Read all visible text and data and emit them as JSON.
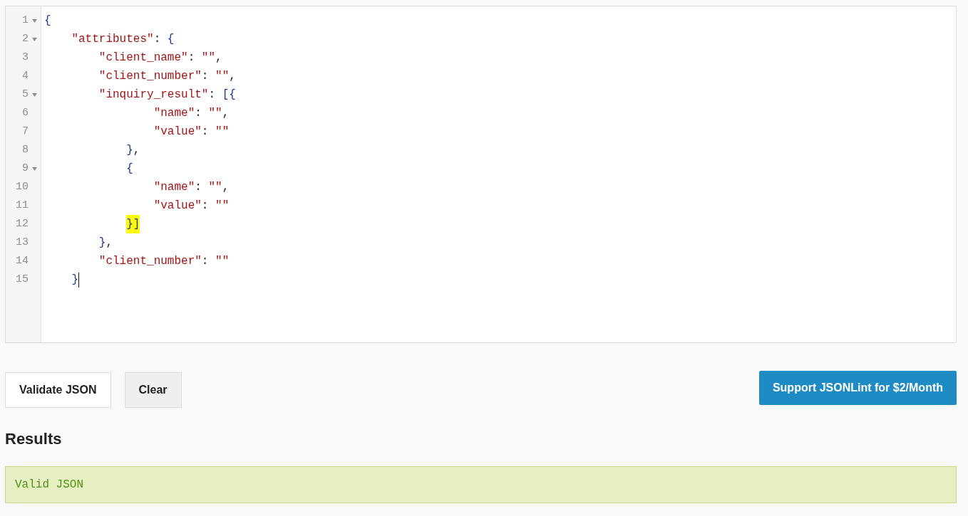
{
  "editor": {
    "lines": [
      {
        "number": "1",
        "code": "{",
        "foldable": true,
        "bracket_match": false,
        "cursor": false
      },
      {
        "number": "2",
        "code": "    \"attributes\": {",
        "foldable": true,
        "bracket_match": false,
        "cursor": false
      },
      {
        "number": "3",
        "code": "        \"client_name\": \"\",",
        "foldable": false,
        "bracket_match": false,
        "cursor": false
      },
      {
        "number": "4",
        "code": "        \"client_number\": \"\",",
        "foldable": false,
        "bracket_match": false,
        "cursor": false
      },
      {
        "number": "5",
        "code": "        \"inquiry_result\": [{",
        "foldable": true,
        "bracket_match": false,
        "cursor": false
      },
      {
        "number": "6",
        "code": "                \"name\": \"\",",
        "foldable": false,
        "bracket_match": false,
        "cursor": false
      },
      {
        "number": "7",
        "code": "                \"value\": \"\"",
        "foldable": false,
        "bracket_match": false,
        "cursor": false
      },
      {
        "number": "8",
        "code": "            },",
        "foldable": false,
        "bracket_match": false,
        "cursor": false
      },
      {
        "number": "9",
        "code": "            {",
        "foldable": true,
        "bracket_match": false,
        "cursor": false
      },
      {
        "number": "10",
        "code": "                \"name\": \"\",",
        "foldable": false,
        "bracket_match": false,
        "cursor": false
      },
      {
        "number": "11",
        "code": "                \"value\": \"\"",
        "foldable": false,
        "bracket_match": false,
        "cursor": false
      },
      {
        "number": "12",
        "code": "            }]",
        "foldable": false,
        "bracket_match": true,
        "cursor": false
      },
      {
        "number": "13",
        "code": "        },",
        "foldable": false,
        "bracket_match": false,
        "cursor": false
      },
      {
        "number": "14",
        "code": "        \"client_number\": \"\"",
        "foldable": false,
        "bracket_match": false,
        "cursor": false
      },
      {
        "number": "15",
        "code": "    }",
        "foldable": false,
        "bracket_match": false,
        "cursor": true
      }
    ]
  },
  "buttons": [
    {
      "label": "Validate JSON",
      "kind": "outline"
    },
    {
      "label": "Clear",
      "kind": "muted"
    }
  ],
  "support_button": {
    "label": "Support JSONLint for $2/Month"
  },
  "results": {
    "title": "Results",
    "message": "Valid JSON",
    "valid": true
  }
}
